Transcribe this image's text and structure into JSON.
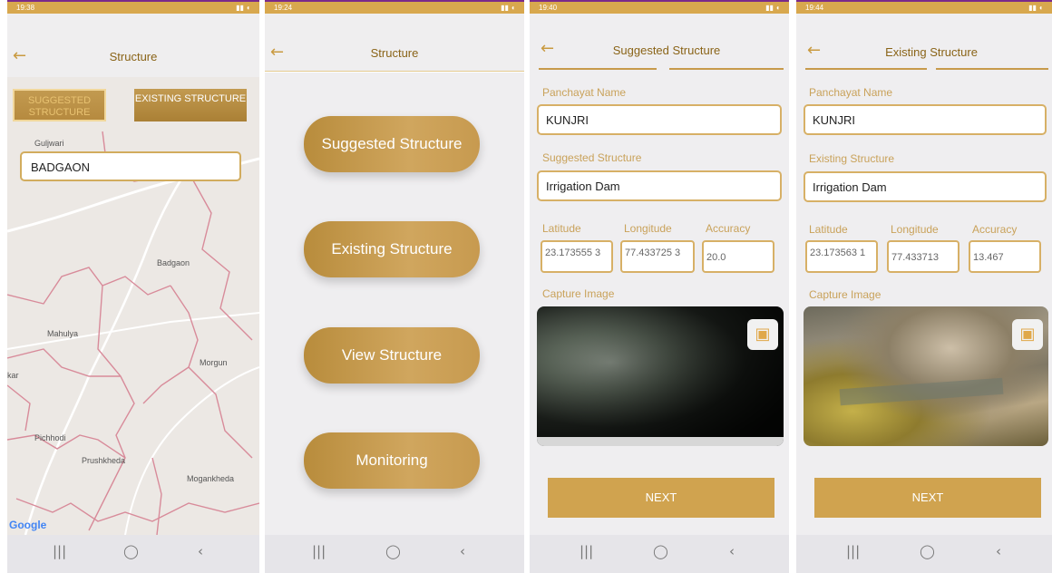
{
  "status_times": [
    "19:38",
    "19:24",
    "19:40",
    "19:44"
  ],
  "screen1": {
    "title": "Structure",
    "tab_suggested": "SUGGESTED STRUCTURE",
    "tab_existing": "EXISTING STRUCTURE",
    "input_value": "BADGAON",
    "map_labels": [
      "Guljwari",
      "Badgaon",
      "Mahulya",
      "Morgun",
      "Pichhodi",
      "Prushkheda",
      "Mogankheda",
      "kar"
    ],
    "attribution": "Google"
  },
  "screen2": {
    "title": "Structure",
    "buttons": [
      "Suggested Structure",
      "Existing Structure",
      "View Structure",
      "Monitoring"
    ]
  },
  "screen3": {
    "title": "Suggested Structure",
    "panchayat_label": "Panchayat Name",
    "panchayat_value": "KUNJRI",
    "structure_label": "Suggested Structure",
    "structure_value": "Irrigation Dam",
    "lat_label": "Latitude",
    "lon_label": "Longitude",
    "acc_label": "Accuracy",
    "lat_value": "23.173555 3",
    "lon_value": "77.433725 3",
    "acc_value": "20.0",
    "capture_label": "Capture Image",
    "next": "NEXT"
  },
  "screen4": {
    "title": "Existing Structure",
    "panchayat_label": "Panchayat Name",
    "panchayat_value": "KUNJRI",
    "structure_label": "Existing Structure",
    "structure_value": "Irrigation Dam",
    "lat_label": "Latitude",
    "lon_label": "Longitude",
    "acc_label": "Accuracy",
    "lat_value": "23.173563 1",
    "lon_value": "77.433713",
    "acc_value": "13.467",
    "capture_label": "Capture Image",
    "next": "NEXT"
  },
  "icons": {
    "back": "back-arrow-icon",
    "camera": "add-photo-icon",
    "nav": [
      "recents-icon",
      "home-icon",
      "back-nav-icon"
    ]
  },
  "colors": {
    "accent": "#c99a40",
    "statusbar": "#d8a84e",
    "field_border": "#d7b066"
  }
}
